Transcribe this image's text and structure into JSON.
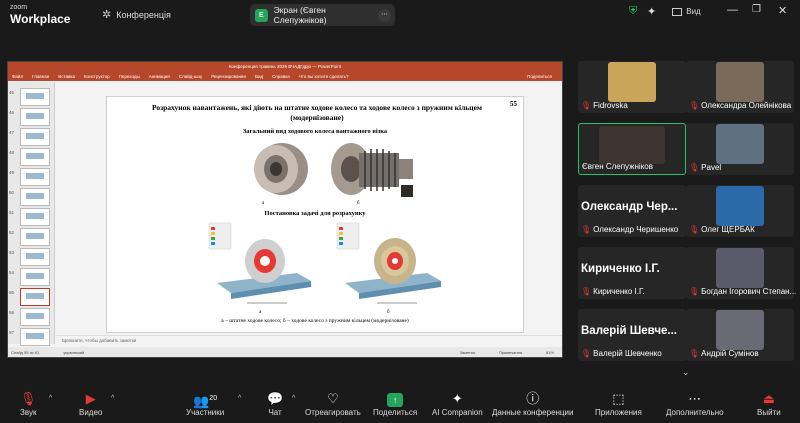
{
  "app": {
    "logo_line1": "zoom",
    "logo_line2": "Workplace",
    "meeting_name": "Конференція"
  },
  "share_pill": {
    "label": "Экран (Євген Слепужніков)",
    "icon_letter": "Е"
  },
  "top_right": {
    "view_label": "Вид"
  },
  "ppt": {
    "title_bar": "Конференция травень 2025 ВЧАДГдрjo  —  PowerPoint",
    "menu": [
      "Файл",
      "Главная",
      "Вставка",
      "Конструктор",
      "Переходы",
      "Анимация",
      "Слайд-шоу",
      "Рецензирование",
      "Вид",
      "Справка",
      "Что вы хотите сделать?"
    ],
    "share_label": "Поделиться",
    "search_box": "Вход",
    "thumb_numbers": [
      "45",
      "46",
      "47",
      "48",
      "49",
      "50",
      "51",
      "52",
      "53",
      "54",
      "55",
      "56",
      "57"
    ],
    "slide": {
      "title": "Розрахунок навантажень, які діють на штатне ходове колесо та ходове колесо з пружним кільцем (модернізоване)",
      "number": "55",
      "subtitle1": "Загальний вид ходового колеса вантажного візка",
      "cap_a": "а",
      "cap_b": "б",
      "subtitle2": "Постановка задачі для розрахунку",
      "bottom_caption": "а – штатне ходове колесо;  б – ходове колесо з пружним кільцем (модернізоване)"
    },
    "notes_placeholder": "Щелкните, чтобы добавить заметки",
    "status": {
      "slide_of": "Слайд 55 из 61",
      "language": "украинский",
      "notes": "Заметки",
      "comments": "Примечания",
      "zoom": "81%"
    }
  },
  "participants": [
    {
      "name": "Fidrovska",
      "muted": true,
      "has_video": true
    },
    {
      "name": "Олександра Олейнікова",
      "muted": true,
      "has_video": true
    },
    {
      "name": "Євген Слепужніков",
      "muted": false,
      "has_video": true,
      "active": true
    },
    {
      "name": "Pavel",
      "muted": true,
      "has_video": true
    },
    {
      "name": "Олександр Черишенко",
      "muted": true,
      "big": "Олександр  Чер..."
    },
    {
      "name": "Олег ЩЕРБАК",
      "muted": true,
      "has_video": true
    },
    {
      "name": "Кириченко І.Г.",
      "muted": true,
      "big": "Кириченко І.Г."
    },
    {
      "name": "Богдан Ігорович Степан...",
      "muted": true,
      "has_video": true
    },
    {
      "name": "Валерій Шевченко",
      "muted": true,
      "big": "Валерій  Шевче..."
    },
    {
      "name": "Андрій Сумінов",
      "muted": true,
      "has_video": true
    }
  ],
  "toolbar": {
    "audio": "Звук",
    "video": "Видео",
    "participants": "Участники",
    "participants_count": "20",
    "chat": "Чат",
    "react": "Отреагировать",
    "share": "Поделиться",
    "ai": "AI Companion",
    "info": "Данные конференции",
    "apps": "Приложения",
    "more": "Дополнительно",
    "leave": "Выйти"
  },
  "colors": {
    "accent_green": "#23c46a",
    "share_green": "#23a55a",
    "ppt_red": "#b7472a",
    "muted_red": "#e53935"
  }
}
